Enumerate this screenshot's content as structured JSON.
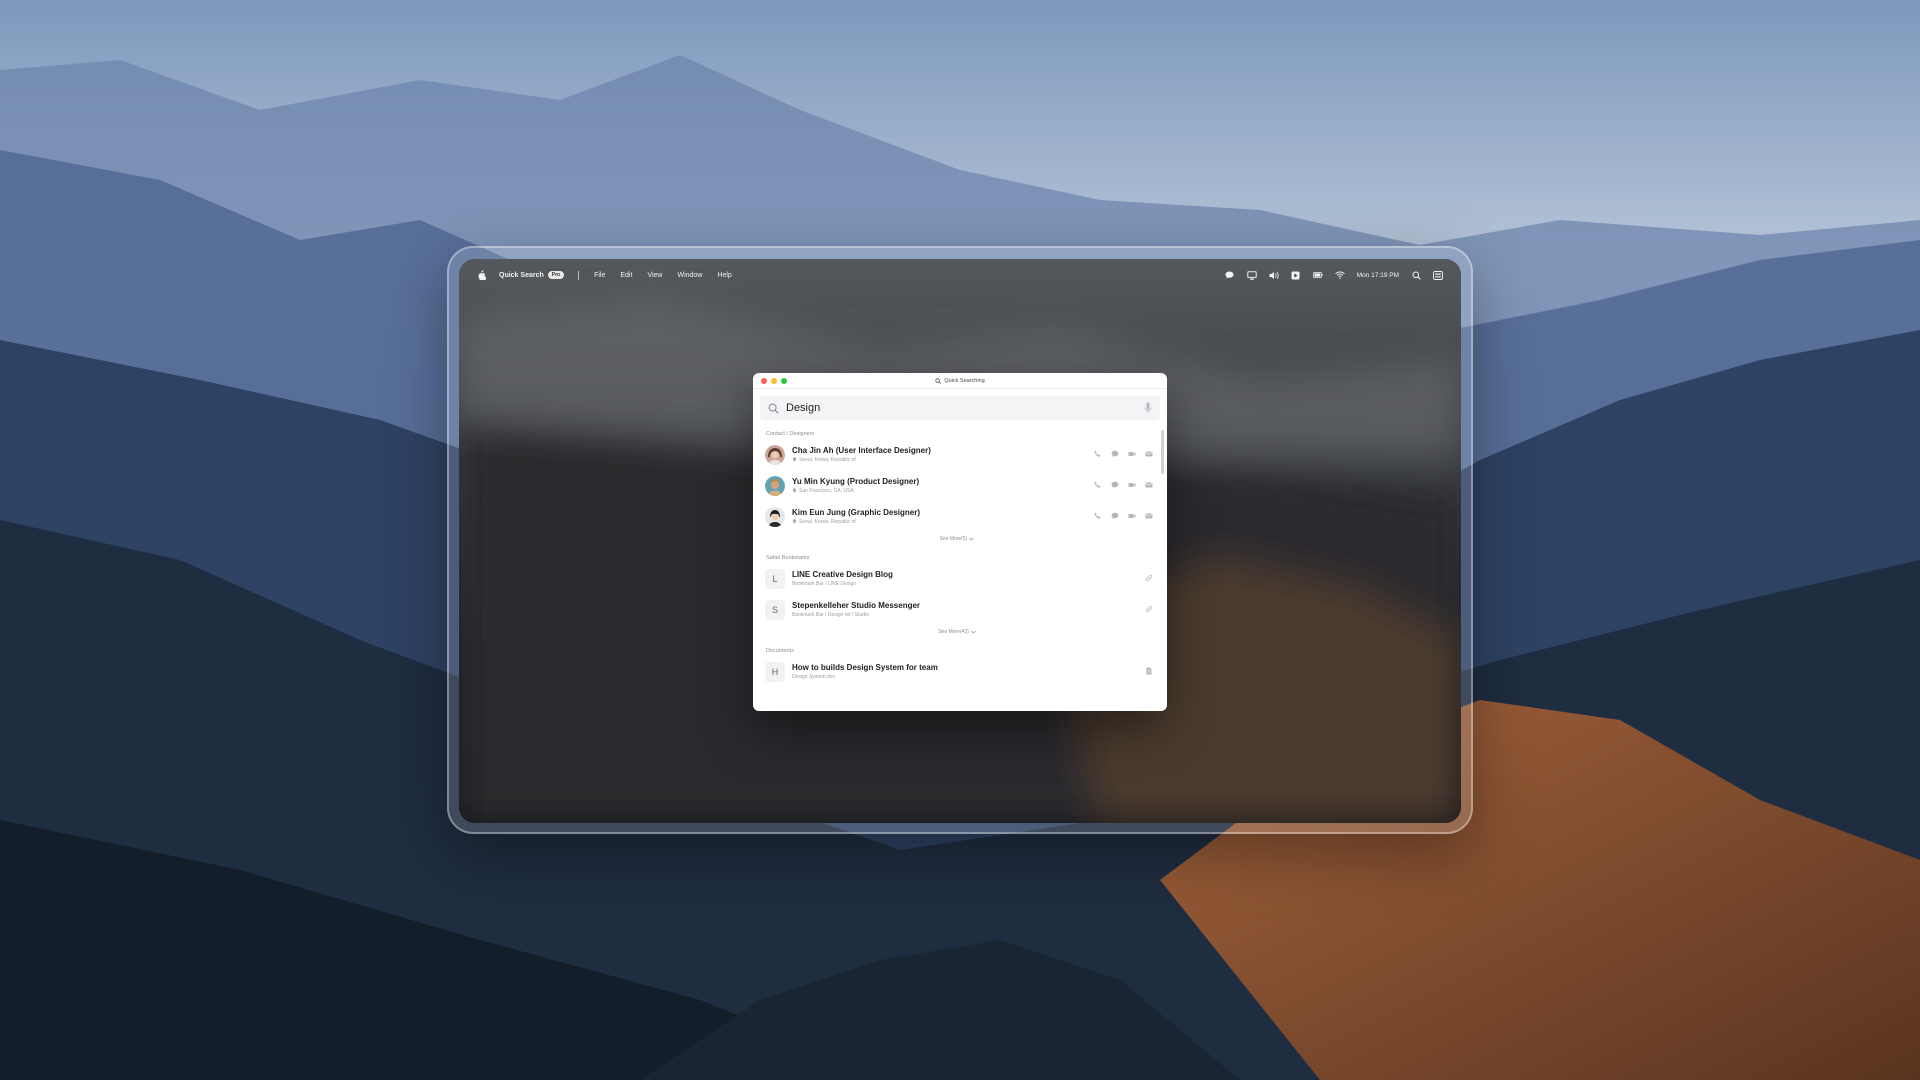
{
  "menubar": {
    "app_name": "Quick Search",
    "badge": "Pro",
    "menus": [
      "File",
      "Edit",
      "View",
      "Window",
      "Help"
    ],
    "clock": "Mon 17:19 PM",
    "status_icons": [
      "messages-icon",
      "display-icon",
      "volume-icon",
      "play-icon",
      "battery-icon",
      "wifi-icon",
      "spotlight-icon",
      "control-center-icon"
    ]
  },
  "window": {
    "title": "Quick Searching",
    "search": {
      "value": "Design",
      "placeholder": "Search"
    }
  },
  "sections": {
    "contacts": {
      "label": "Contact / Designers",
      "items": [
        {
          "name": "Cha Jin Ah (User Interface Designer)",
          "location": "Seoul, Korea, Republic of"
        },
        {
          "name": "Yu Min Kyung (Product Designer)",
          "location": "San Francisco, CA, USA"
        },
        {
          "name": "Kim Eun Jung (Graphic Designer)",
          "location": "Seoul, Korea, Republic of"
        }
      ],
      "see_more": "See More(5)"
    },
    "bookmarks": {
      "label": "Safari Bookmarks",
      "items": [
        {
          "letter": "L",
          "title": "LINE Creative Design Blog",
          "path": "Bookmark Bar / LINE Design"
        },
        {
          "letter": "S",
          "title": "Stepenkelleher Studio Messenger",
          "path": "Bookmark Bar / Design ref / Studio"
        }
      ],
      "see_more": "See More(43)"
    },
    "documents": {
      "label": "Documents",
      "items": [
        {
          "letter": "H",
          "title": "How to builds Design System for team",
          "path": "Design System.doc"
        }
      ]
    }
  },
  "colors": {
    "traffic_red": "#ff5f57",
    "traffic_yellow": "#febc2e",
    "traffic_green": "#28c840"
  }
}
